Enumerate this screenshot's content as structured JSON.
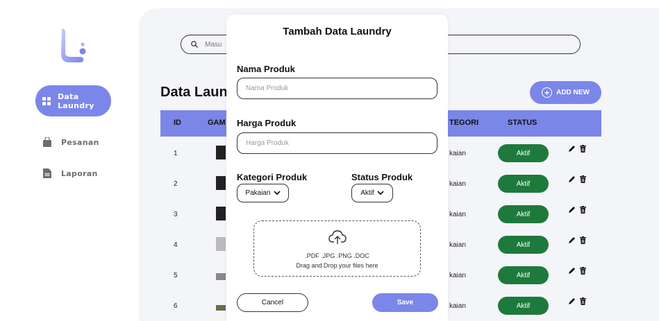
{
  "sidebar": {
    "items": [
      {
        "label_line1": "Data",
        "label_line2": "Laundry",
        "icon": "grid-icon",
        "active": true
      },
      {
        "label": "Pesanan",
        "icon": "bag-icon"
      },
      {
        "label": "Laporan",
        "icon": "document-icon"
      }
    ]
  },
  "search": {
    "placeholder": "Masu"
  },
  "page_title": "Data Laun",
  "add_new_label": "ADD NEW",
  "table": {
    "headers": {
      "id": "ID",
      "gambar": "GAM",
      "kategori": "TEGORI",
      "status": "STATUS"
    },
    "rows": [
      {
        "id": "1",
        "kategori": "kaian",
        "status": "Aktif"
      },
      {
        "id": "2",
        "kategori": "kaian",
        "status": "Aktif"
      },
      {
        "id": "3",
        "kategori": "kaian",
        "status": "Aktif"
      },
      {
        "id": "4",
        "kategori": "kaian",
        "status": "Aktif"
      },
      {
        "id": "5",
        "kategori": "kaian",
        "status": "Aktif"
      },
      {
        "id": "6",
        "kategori": "kaian",
        "status": "Aktif"
      }
    ]
  },
  "modal": {
    "title": "Tambah Data Laundry",
    "nama_label": "Nama Produk",
    "nama_placeholder": "Nama Produk",
    "harga_label": "Harga Produk",
    "harga_placeholder": "Harga Produk",
    "kategori_label": "Kategori Produk",
    "kategori_value": "Pakaian",
    "status_label": "Status Produk",
    "status_value": "Aktif",
    "upload_formats": ".PDF .JPG .PNG .DOC",
    "upload_hint": "Drag and Drop your files here",
    "cancel_label": "Cancel",
    "save_label": "Save"
  },
  "colors": {
    "accent": "#7b86e9",
    "status_green": "#1e7a3c"
  }
}
